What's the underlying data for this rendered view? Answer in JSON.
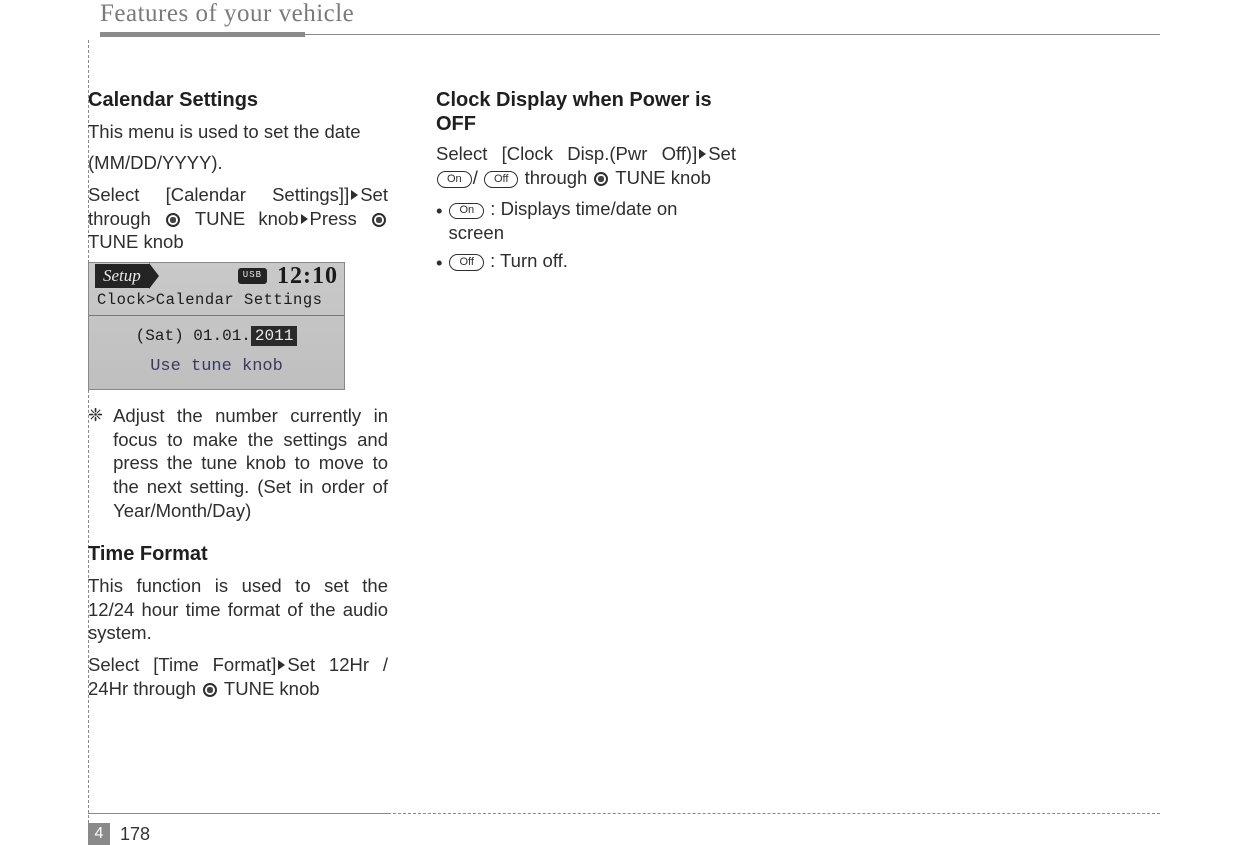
{
  "header": {
    "running_title": "Features of your vehicle"
  },
  "footer": {
    "chapter": "4",
    "page": "178"
  },
  "col1": {
    "h_calendar": "Calendar Settings",
    "cal_intro1": "This menu is used to set the date",
    "cal_intro2": "(MM/DD/YYYY).",
    "cal_sel_a": "Select [Calendar Settings]]",
    "cal_sel_b": "Set through ",
    "cal_sel_c": " TUNE knob",
    "cal_sel_d": "Press ",
    "cal_sel_e": " TUNE knob",
    "note_symbol": "❈",
    "note_text": "Adjust the number currently in focus to make the settings and press the tune knob to move to the next setting. (Set in order of Year/Month/Day)",
    "h_time": "Time Format",
    "time_p1": "This function is used to set the 12/24 hour time format of the audio system.",
    "time_sel_a": "Select [Time Format]",
    "time_sel_b": "Set 12Hr / 24Hr through ",
    "time_sel_c": " TUNE knob"
  },
  "device": {
    "setup": "Setup",
    "usb": "USB",
    "clock": "12:10",
    "breadcrumb": "Clock>Calendar Settings",
    "day": "(Sat)",
    "date": "01.01.",
    "year": "2011",
    "hint": "Use tune knob"
  },
  "col2": {
    "h_clock": "Clock Display when Power is OFF",
    "cd_sel_a": "Select [Clock Disp.(Pwr Off)]",
    "cd_sel_b": "Set ",
    "cd_sel_c": " through ",
    "cd_sel_d": " TUNE knob",
    "on": "On",
    "off": "Off",
    "on_desc": " : Displays time/date on screen",
    "off_desc": " : Turn off."
  }
}
